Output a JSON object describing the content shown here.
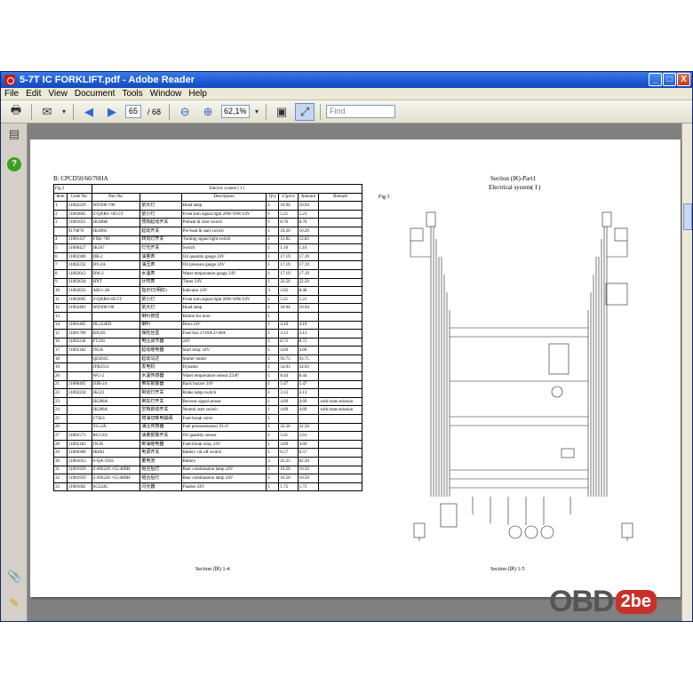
{
  "window": {
    "title": "5-7T IC FORKLIFT.pdf - Adobe Reader",
    "btn_min": "_",
    "btn_max": "□",
    "btn_close": "X"
  },
  "menu": [
    "File",
    "Edit",
    "View",
    "Document",
    "Tools",
    "Window",
    "Help"
  ],
  "toolbar": {
    "page_current": "65",
    "page_total": "/ 68",
    "zoom": "62,1%",
    "find_placeholder": "Find"
  },
  "doc": {
    "left_heading": "B: CPCD50/60/70HA",
    "fig_caption": "Fig 2",
    "system_caption": "Electric system ( I )",
    "columns": [
      "Item",
      "Code No.",
      "Part No.",
      "",
      "Description",
      "Q'ty",
      "U'price",
      "Amount",
      "Remark"
    ],
    "rows": [
      [
        "1",
        "11002229",
        "WD100 ×90",
        "前大灯",
        "Head lamp",
        "1",
        "10.94",
        "10.94",
        ""
      ],
      [
        "2",
        "11002005",
        "Z-QXRS ×85/5T",
        "前小灯",
        "Front turn signal light 20W/10W/24V",
        "1",
        "5.21",
        "5.21",
        ""
      ],
      [
        "3",
        "11001051",
        "JK406B",
        "预热起动开关",
        "Preheat & start switch",
        "1",
        "8.76",
        "8.76",
        ""
      ],
      [
        "",
        "9170876",
        "JK406C",
        "起动开关",
        "Pre-heat & start switch",
        "1",
        "10.20",
        "10.20",
        ""
      ],
      [
        "4",
        "11001437",
        "FXK-700",
        "转向灯开关",
        "Turning signal light switch",
        "1",
        "12.82",
        "12.82",
        ""
      ],
      [
        "5",
        "11000427",
        "JK107",
        "灯光开关",
        "Switch",
        "1",
        "1.16",
        "1.16",
        ""
      ],
      [
        "6",
        "11002306",
        "DR-2",
        "油量表",
        "Oil quantity gauge 24V",
        "1",
        "17.19",
        "17.19",
        ""
      ],
      [
        "7",
        "11002232",
        "DY-2A",
        "油压表",
        "Oil pressure gauge 24V",
        "1",
        "17.19",
        "17.19",
        ""
      ],
      [
        "8",
        "11002012",
        "DW-2",
        "水温表",
        "Water temperature gauge 24V",
        "1",
        "17.19",
        "17.19",
        ""
      ],
      [
        "9",
        "11002634",
        "HXT",
        "计时表",
        "Timer 24V",
        "1",
        "22.50",
        "22.50",
        ""
      ],
      [
        "10",
        "11002633",
        "AB11-28",
        "指示灯(明红)",
        "Indicator 24V",
        "3",
        "2.82",
        "8.46",
        ""
      ],
      [
        "11",
        "11002005",
        "Z-QXRS×85/5T",
        "前小灯",
        "Front turn signal light 20W/10W/24V",
        "1",
        "5.21",
        "5.21",
        ""
      ],
      [
        "12",
        "11002403",
        "WD100×90",
        "前大灯",
        "Head lamp",
        "1",
        "10.94",
        "10.94",
        ""
      ],
      [
        "13",
        "",
        "",
        "喇叭按钮",
        "Button for horn",
        "1",
        "",
        "",
        ""
      ],
      [
        "14",
        "11001405",
        "DL224ED",
        "喇叭",
        "Horn 24V",
        "1",
        "4.10",
        "4.10",
        ""
      ],
      [
        "15",
        "11001709",
        "BX505",
        "保险丝盒",
        "Fuse box 2×10A 2×40A",
        "1",
        "3.13",
        "3.13",
        ""
      ],
      [
        "16",
        "11002238",
        "FT226",
        "电压调节器",
        "24V",
        "1",
        "8.72",
        "8.72",
        ""
      ],
      [
        "17",
        "11002182",
        "JN3A",
        "起动继电器",
        "Start relay 24V",
        "1",
        "4.69",
        "4.69",
        ""
      ],
      [
        "18",
        "",
        "QD263C",
        "起动马达",
        "Starter motor",
        "1",
        "93.75",
        "93.75",
        ""
      ],
      [
        "19",
        "",
        "JFB2312",
        "发电机",
        "Dynamo",
        "1",
        "54.03",
        "54.03",
        ""
      ],
      [
        "20",
        "",
        "WG-2",
        "水温传感器",
        "Water temperature sensor Z3/8\"",
        "1",
        "8.44",
        "8.44",
        ""
      ],
      [
        "21",
        "11000405",
        "DJB-24",
        "倒车报警器",
        "Back buzzer 24V",
        "1",
        "5.47",
        "5.47",
        ""
      ],
      [
        "22",
        "11002224",
        "JK221",
        "制动灯开关",
        "Brake lamp switch",
        "1",
        "3.13",
        "3.13",
        ""
      ],
      [
        "23",
        "",
        "JK208A",
        "倒车灯开关",
        "Reverse signal sensor",
        "1",
        "4.69",
        "4.69",
        "with trans-mission"
      ],
      [
        "24",
        "",
        "JK208A",
        "空档启动开关",
        "Neutral start switch",
        "1",
        "4.69",
        "4.69",
        "with trans-mission"
      ],
      [
        "25",
        "",
        "175ES",
        "燃油切断电磁阀",
        "Fuel-break valve",
        "1",
        "",
        "",
        ""
      ],
      [
        "26",
        "",
        "YG-2A",
        "油压传感器",
        "Fuel pressuresensor Z1/4\"",
        "1",
        "22.50",
        "22.50",
        ""
      ],
      [
        "27",
        "11001573",
        "RG1161",
        "油量报警开关",
        "Oil quantity sensor",
        "1",
        "5.61",
        "5.61",
        ""
      ],
      [
        "28",
        "11002182",
        "JN3A",
        "断油继电器",
        "Fuel-break relay 24V",
        "1",
        "4.69",
        "4.69",
        ""
      ],
      [
        "29",
        "11000300",
        "JK861",
        "电源开关",
        "Battery cut off switch",
        "1",
        "6.57",
        "6.57",
        ""
      ],
      [
        "30",
        "11001015",
        "6-QA-105S",
        "蓄电池",
        "Battery",
        "2",
        "41.25",
        "82.50",
        ""
      ],
      [
        "31",
        "11001959",
        "Z-HX220 ×55/40DH",
        "组合后灯",
        "Rear combination lamp 24V",
        "1",
        "10.50",
        "10.50",
        ""
      ],
      [
        "32",
        "11001959",
        "Z-HX220 ×55/40DH",
        "组合后灯",
        "Rear combination lamp 24V",
        "1",
        "10.50",
        "10.50",
        ""
      ],
      [
        "33",
        "11001062",
        "SG224C",
        "闪光器",
        "Flasher 24V",
        "1",
        "1.72",
        "1.72",
        ""
      ]
    ],
    "footer_left": "Section (Ⅸ)    1-4",
    "right_title": "Section (Ⅸ)-Part1",
    "right_subtitle": "Electrical system( I )",
    "fig_label": "Fig 3",
    "footer_right": "Section (Ⅸ)    1-5"
  },
  "watermark": {
    "text": "OBD",
    "badge": "2be"
  }
}
